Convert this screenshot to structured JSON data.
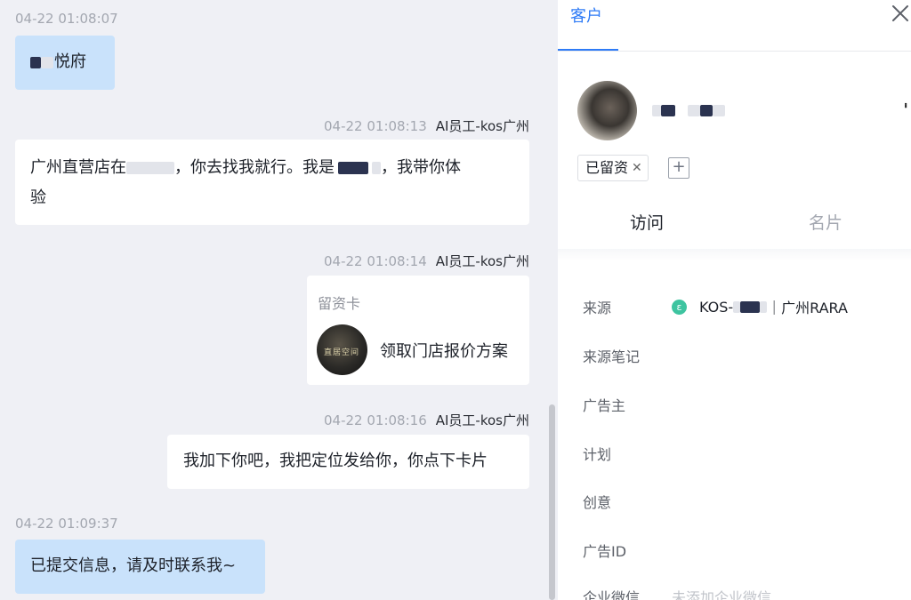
{
  "chat": {
    "messages": [
      {
        "time": "04-22 01:08:07",
        "text": "悦府"
      },
      {
        "time": "04-22 01:08:13",
        "sender": "AI员工-kos广州",
        "text_a": "广州直营店在",
        "text_b": "，你去找我就行。我是",
        "text_c": "，我带你体",
        "text_d": "验"
      },
      {
        "time": "04-22 01:08:14",
        "sender": "AI员工-kos广州",
        "card_title": "留资卡",
        "card_text": "领取门店报价方案",
        "card_thumb_text": "直居空间"
      },
      {
        "time": "04-22 01:08:16",
        "sender": "AI员工-kos广州",
        "text": "我加下你吧，我把定位发给你，你点下卡片"
      },
      {
        "time": "04-22 01:09:37",
        "text": "已提交信息，请及时联系我~"
      }
    ]
  },
  "panel": {
    "tab": "客户",
    "close_icon": "close-icon",
    "tag": "已留资",
    "tag_add": "+",
    "subtabs": [
      "访问",
      "名片"
    ],
    "fields": [
      {
        "label": "来源",
        "value": "KOS-",
        "value_tail": "｜广州RARA",
        "icon": "source-icon",
        "icon_color": "#3ec4a0"
      },
      {
        "label": "来源笔记"
      },
      {
        "label": "广告主"
      },
      {
        "label": "计划"
      },
      {
        "label": "创意"
      },
      {
        "label": "广告ID"
      },
      {
        "label": "企业微信",
        "placeholder": "未添加企业微信"
      }
    ]
  },
  "colors": {
    "accent": "#2e7bf6",
    "chat_bg": "#eff0f5",
    "bubble_blue": "#c9e2fb"
  }
}
